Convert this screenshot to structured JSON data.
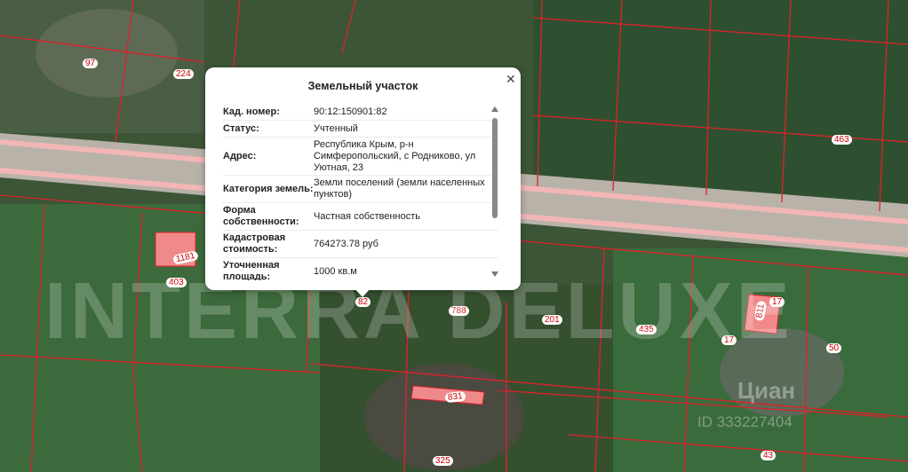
{
  "popup": {
    "title": "Земельный участок",
    "close_icon": "close-icon",
    "rows": [
      {
        "label": "Кад. номер:",
        "value": "90:12:150901:82"
      },
      {
        "label": "Статус:",
        "value": "Учтенный"
      },
      {
        "label": "Адрес:",
        "value": "Республика Крым, р-н Симферопольский, с Родниково, ул Уютная, 23"
      },
      {
        "label": "Категория земель:",
        "value": "Земли поселений (земли населенных пунктов)"
      },
      {
        "label": "Форма собственности:",
        "value": "Частная собственность"
      },
      {
        "label": "Кадастровая стоимость:",
        "value": "764273.78 руб"
      },
      {
        "label": "Уточненная площадь:",
        "value": "1000 кв.м"
      }
    ]
  },
  "map": {
    "parcel_numbers": [
      "97",
      "224",
      "463",
      "1181",
      "403",
      "82",
      "788",
      "201",
      "435",
      "17",
      "811",
      "17",
      "50",
      "831",
      "325",
      "43"
    ],
    "watermark": "INTERRA DELUXE",
    "cian_label": "Циан",
    "cian_id": "ID 333227404",
    "colors": {
      "parcel_line": "#e0202a",
      "road": "#f2b6b6",
      "building": "#f08a8a"
    }
  }
}
